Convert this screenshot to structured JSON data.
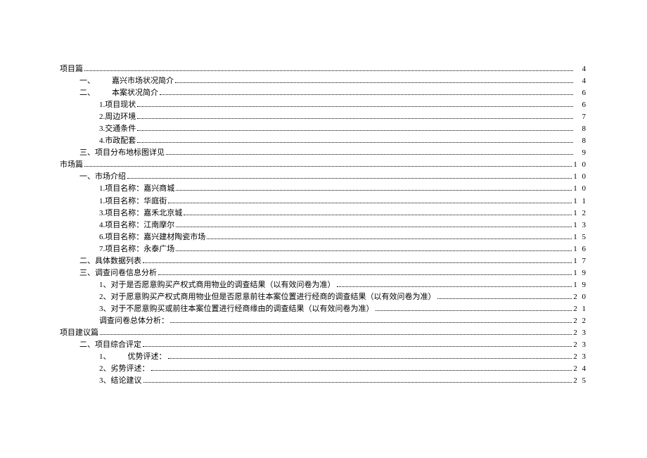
{
  "toc": [
    {
      "level": 0,
      "text": "项目篇",
      "page": "4"
    },
    {
      "level": 1,
      "text": "一、",
      "sep": true,
      "text2": "嘉兴市场状况简介",
      "page": "4"
    },
    {
      "level": 1,
      "text": "二、",
      "sep": true,
      "text2": "本案状况简介",
      "page": "6"
    },
    {
      "level": 2,
      "text": "1.项目现状",
      "page": "6"
    },
    {
      "level": 2,
      "text": "2.周边环境",
      "page": "7"
    },
    {
      "level": 2,
      "text": "3.交通条件",
      "page": "8"
    },
    {
      "level": 2,
      "text": "4.市政配套",
      "page": "8"
    },
    {
      "level": 1,
      "text": "三、项目分布地标图详见",
      "page": "9"
    },
    {
      "level": 0,
      "text": "市场篇",
      "page": "1 0"
    },
    {
      "level": 1,
      "text": "一、市场介绍",
      "page": "1 0"
    },
    {
      "level": 2,
      "text": "1.项目名称：嘉兴商城",
      "page": "1 0"
    },
    {
      "level": 2,
      "text": "1.项目名称：华庭街",
      "page": "1 1"
    },
    {
      "level": 2,
      "text": "3.项目名称：嘉禾北京城",
      "page": "1 2"
    },
    {
      "level": 2,
      "text": "4.项目名称：江南摩尔",
      "page": "1 3"
    },
    {
      "level": 2,
      "text": "6.项目名称：嘉兴建材陶瓷市场",
      "page": "1 5"
    },
    {
      "level": 2,
      "text": "7.项目名称：永泰广场",
      "page": "1 6"
    },
    {
      "level": 1,
      "text": "二、具体数据列表",
      "page": "1 7"
    },
    {
      "level": 1,
      "text": "三、调查问卷信息分析",
      "page": "1 9"
    },
    {
      "level": 2,
      "text": "1、对于是否愿意购买产权式商用物业的调查结果（以有效问卷为准）",
      "page": "1 9"
    },
    {
      "level": 2,
      "text": "2、对于愿意购买产权式商用物业但是否愿意前往本案位置进行经商的调查结果（以有效问卷为准）",
      "page": "2 0"
    },
    {
      "level": 2,
      "text": "3、对于不愿意购买或前往本案位置进行经商缘由的调查结果（以有效问卷为准）",
      "page": "2 1"
    },
    {
      "level": 2,
      "text": "调查问卷总体分析：",
      "page": "2 2"
    },
    {
      "level": 0,
      "text": "项目建议篇",
      "page": "2 3"
    },
    {
      "level": 1,
      "text": "二、项目综合评定",
      "page": "2 3"
    },
    {
      "level": 2,
      "text": "1、",
      "sep": true,
      "text2": "优势评述：",
      "page": "2 3"
    },
    {
      "level": 2,
      "text": "2、劣势评述：",
      "page": "2 4"
    },
    {
      "level": 2,
      "text": "3、结论建议",
      "page": "2 5"
    }
  ]
}
